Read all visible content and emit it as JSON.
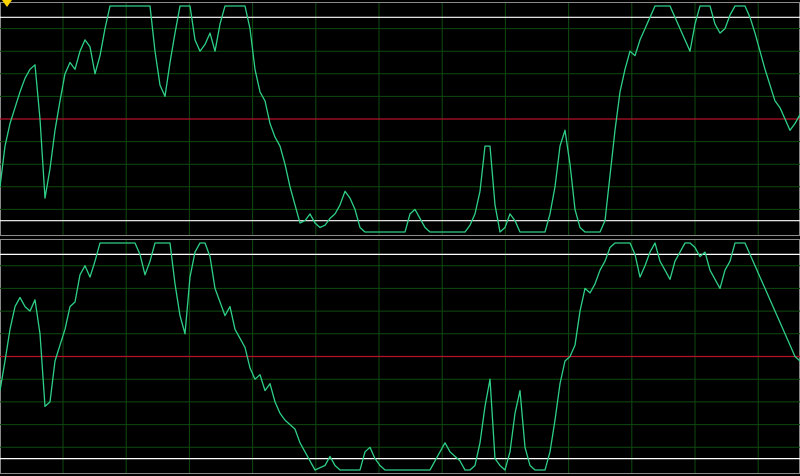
{
  "app": {
    "indicator_label": ""
  },
  "colors": {
    "background": "#000000",
    "grid": "#0f4a0f",
    "signal": "#2ecf87",
    "level": "#ffffff",
    "midline": "#b5122a",
    "frame": "#8a8a8a",
    "indicator": "#ffd400"
  },
  "chart_data": [
    {
      "type": "line",
      "title": "",
      "xlabel": "",
      "ylabel": "",
      "xlim": [
        0,
        800
      ],
      "ylim": [
        0,
        100
      ],
      "grid": true,
      "reference_levels": {
        "upper": 95,
        "middle": 50,
        "lower": 5
      },
      "series": [
        {
          "x": [
            0,
            5,
            10,
            15,
            20,
            25,
            30,
            35,
            40,
            45,
            50,
            55,
            60,
            65,
            70,
            75,
            80,
            85,
            90,
            95,
            100,
            105,
            110,
            115,
            120,
            125,
            130,
            135,
            140,
            145,
            150,
            155,
            160,
            165,
            170,
            175,
            180,
            185,
            190,
            195,
            200,
            205,
            210,
            215,
            220,
            225,
            230,
            235,
            240,
            245,
            250,
            255,
            260,
            265,
            270,
            275,
            280,
            285,
            290,
            295,
            300,
            305,
            310,
            315,
            320,
            325,
            330,
            335,
            340,
            345,
            350,
            355,
            360,
            365,
            370,
            375,
            380,
            385,
            390,
            395,
            400,
            405,
            410,
            415,
            420,
            425,
            430,
            435,
            440,
            445,
            450,
            455,
            460,
            465,
            470,
            475,
            480,
            485,
            490,
            495,
            500,
            505,
            510,
            515,
            520,
            525,
            530,
            535,
            540,
            545,
            550,
            555,
            560,
            565,
            570,
            575,
            580,
            585,
            590,
            595,
            600,
            605,
            610,
            615,
            620,
            625,
            630,
            635,
            640,
            645,
            650,
            655,
            660,
            665,
            670,
            675,
            680,
            685,
            690,
            695,
            700,
            705,
            710,
            715,
            720,
            725,
            730,
            735,
            740,
            745,
            750,
            755,
            760,
            765,
            770,
            775,
            780,
            785,
            790,
            795,
            800
          ],
          "values": [
            20,
            38,
            48,
            55,
            62,
            68,
            72,
            74,
            50,
            15,
            28,
            45,
            58,
            70,
            75,
            72,
            80,
            85,
            82,
            70,
            78,
            90,
            100,
            100,
            100,
            100,
            100,
            100,
            100,
            100,
            100,
            80,
            65,
            60,
            75,
            88,
            100,
            100,
            100,
            85,
            80,
            83,
            88,
            80,
            92,
            100,
            100,
            100,
            100,
            100,
            90,
            72,
            62,
            58,
            48,
            42,
            38,
            30,
            20,
            12,
            4,
            5,
            8,
            4,
            2,
            3,
            6,
            8,
            12,
            18,
            15,
            10,
            2,
            0,
            0,
            0,
            0,
            0,
            0,
            0,
            0,
            0,
            8,
            10,
            6,
            2,
            0,
            0,
            0,
            0,
            0,
            0,
            0,
            0,
            3,
            8,
            18,
            38,
            38,
            12,
            0,
            2,
            8,
            5,
            0,
            0,
            0,
            0,
            0,
            0,
            8,
            20,
            38,
            45,
            30,
            10,
            2,
            0,
            0,
            0,
            0,
            5,
            25,
            45,
            62,
            72,
            80,
            78,
            85,
            90,
            95,
            100,
            100,
            100,
            100,
            95,
            90,
            85,
            80,
            92,
            100,
            100,
            100,
            92,
            88,
            90,
            96,
            100,
            100,
            100,
            95,
            88,
            80,
            72,
            65,
            58,
            55,
            50,
            45,
            48,
            52
          ]
        }
      ]
    },
    {
      "type": "line",
      "title": "",
      "xlabel": "",
      "ylabel": "",
      "xlim": [
        0,
        800
      ],
      "ylim": [
        0,
        100
      ],
      "grid": true,
      "reference_levels": {
        "upper": 95,
        "middle": 50,
        "lower": 5
      },
      "series": [
        {
          "x": [
            0,
            5,
            10,
            15,
            20,
            25,
            30,
            35,
            40,
            45,
            50,
            55,
            60,
            65,
            70,
            75,
            80,
            85,
            90,
            95,
            100,
            105,
            110,
            115,
            120,
            125,
            130,
            135,
            140,
            145,
            150,
            155,
            160,
            165,
            170,
            175,
            180,
            185,
            190,
            195,
            200,
            205,
            210,
            215,
            220,
            225,
            230,
            235,
            240,
            245,
            250,
            255,
            260,
            265,
            270,
            275,
            280,
            285,
            290,
            295,
            300,
            305,
            310,
            315,
            320,
            325,
            330,
            335,
            340,
            345,
            350,
            355,
            360,
            365,
            370,
            375,
            380,
            385,
            390,
            395,
            400,
            405,
            410,
            415,
            420,
            425,
            430,
            435,
            440,
            445,
            450,
            455,
            460,
            465,
            470,
            475,
            480,
            485,
            490,
            495,
            500,
            505,
            510,
            515,
            520,
            525,
            530,
            535,
            540,
            545,
            550,
            555,
            560,
            565,
            570,
            575,
            580,
            585,
            590,
            595,
            600,
            605,
            610,
            615,
            620,
            625,
            630,
            635,
            640,
            645,
            650,
            655,
            660,
            665,
            670,
            675,
            680,
            685,
            690,
            695,
            700,
            705,
            710,
            715,
            720,
            725,
            730,
            735,
            740,
            745,
            750,
            755,
            760,
            765,
            770,
            775,
            780,
            785,
            790,
            795,
            800
          ],
          "values": [
            35,
            48,
            62,
            72,
            76,
            72,
            70,
            75,
            60,
            28,
            30,
            48,
            55,
            62,
            72,
            74,
            86,
            90,
            85,
            92,
            100,
            100,
            100,
            100,
            100,
            100,
            100,
            100,
            95,
            86,
            92,
            100,
            100,
            100,
            100,
            82,
            68,
            60,
            85,
            96,
            100,
            100,
            94,
            80,
            74,
            68,
            72,
            62,
            58,
            54,
            45,
            40,
            42,
            35,
            38,
            30,
            25,
            22,
            20,
            18,
            12,
            8,
            4,
            0,
            1,
            2,
            6,
            2,
            0,
            0,
            0,
            0,
            0,
            8,
            10,
            5,
            2,
            0,
            0,
            0,
            0,
            0,
            0,
            0,
            0,
            0,
            0,
            4,
            8,
            12,
            8,
            6,
            4,
            0,
            0,
            2,
            12,
            28,
            40,
            5,
            2,
            0,
            8,
            25,
            35,
            10,
            2,
            0,
            0,
            0,
            8,
            22,
            38,
            48,
            50,
            55,
            70,
            80,
            78,
            82,
            88,
            92,
            98,
            100,
            100,
            100,
            100,
            95,
            85,
            90,
            96,
            100,
            92,
            88,
            84,
            92,
            96,
            100,
            100,
            98,
            94,
            96,
            88,
            84,
            80,
            88,
            92,
            100,
            100,
            100,
            95,
            90,
            85,
            80,
            75,
            70,
            65,
            60,
            55,
            50,
            48
          ]
        }
      ]
    }
  ]
}
